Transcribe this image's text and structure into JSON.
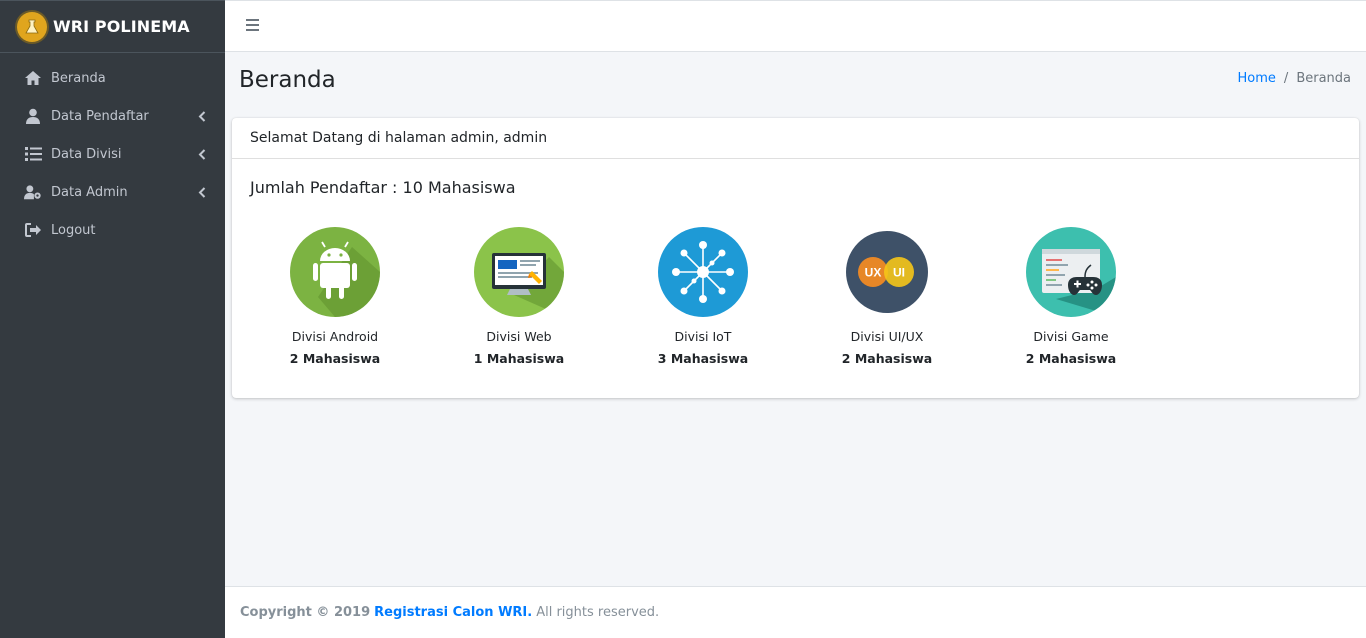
{
  "brand": {
    "name": "WRI POLINEMA"
  },
  "sidebar": {
    "items": [
      {
        "label": "Beranda",
        "icon": "home-icon",
        "has_submenu": false
      },
      {
        "label": "Data Pendaftar",
        "icon": "user-icon",
        "has_submenu": true
      },
      {
        "label": "Data Divisi",
        "icon": "list-icon",
        "has_submenu": true
      },
      {
        "label": "Data Admin",
        "icon": "user-cog-icon",
        "has_submenu": true
      },
      {
        "label": "Logout",
        "icon": "logout-icon",
        "has_submenu": false
      }
    ]
  },
  "header": {
    "title": "Beranda",
    "breadcrumb": {
      "home": "Home",
      "separator": "/",
      "current": "Beranda"
    }
  },
  "card": {
    "welcome": "Selamat Datang di halaman admin, admin",
    "count_title": "Jumlah Pendaftar : 10 Mahasiswa",
    "divisions": [
      {
        "name": "Divisi Android",
        "count": "2 Mahasiswa",
        "icon": "android-icon",
        "color": "#7cb342"
      },
      {
        "name": "Divisi Web",
        "count": "1 Mahasiswa",
        "icon": "web-monitor-icon",
        "color": "#8bc34a"
      },
      {
        "name": "Divisi IoT",
        "count": "3 Mahasiswa",
        "icon": "iot-network-icon",
        "color": "#1e9ad6"
      },
      {
        "name": "Divisi UI/UX",
        "count": "2 Mahasiswa",
        "icon": "uiux-icon",
        "color": "#3e5168"
      },
      {
        "name": "Divisi Game",
        "count": "2 Mahasiswa",
        "icon": "game-controller-icon",
        "color": "#3dbfae"
      }
    ],
    "uiux_labels": {
      "ux": "UX",
      "ui": "UI"
    }
  },
  "footer": {
    "prefix": "Copyright © 2019",
    "link": "Registrasi Calon WRI.",
    "suffix": "All rights reserved."
  },
  "colors": {
    "sidebar_bg": "#343a40",
    "accent": "#007bff",
    "content_bg": "#f4f6f9"
  }
}
